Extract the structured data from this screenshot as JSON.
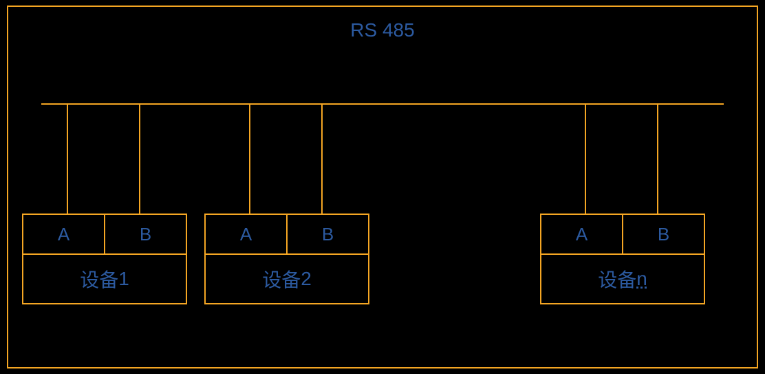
{
  "title": "RS 485",
  "bus": {
    "terminal_a": "A",
    "terminal_b": "B"
  },
  "devices": [
    {
      "label_prefix": "设备",
      "label_suffix": "1",
      "underline_suffix": false
    },
    {
      "label_prefix": "设备",
      "label_suffix": "2",
      "underline_suffix": false
    },
    {
      "label_prefix": "设备",
      "label_suffix": "n",
      "underline_suffix": true
    }
  ]
}
